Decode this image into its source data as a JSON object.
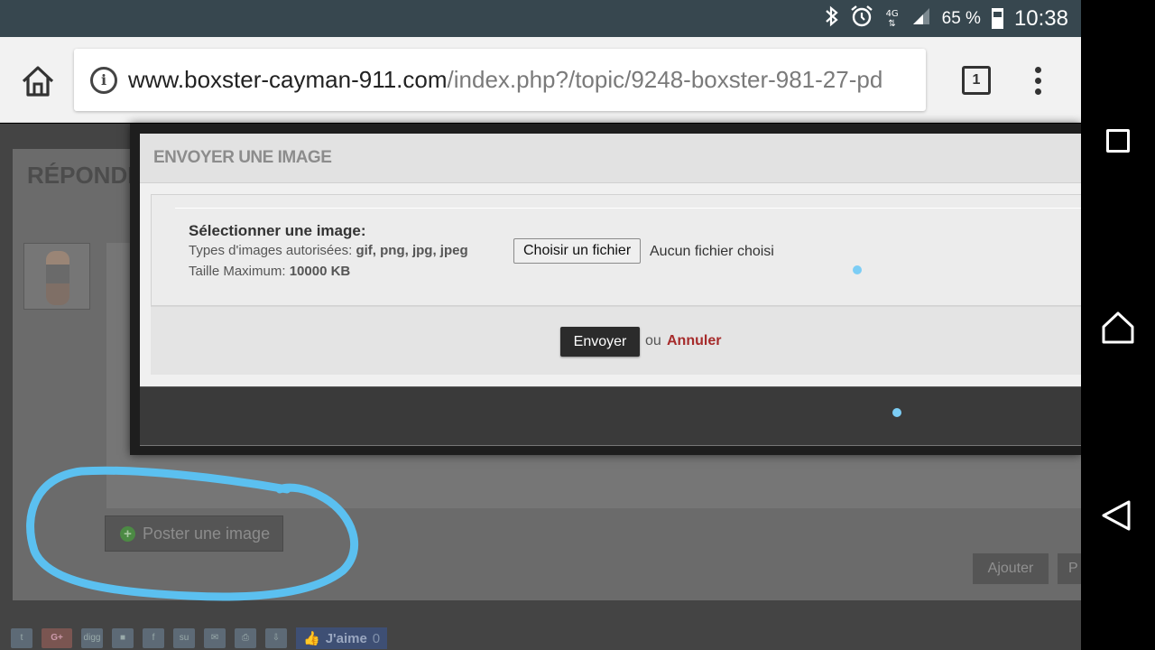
{
  "status_bar": {
    "network": "4G",
    "battery_percent": "65 %",
    "time": "10:38",
    "icons": [
      "bluetooth-icon",
      "alarm-icon",
      "data-arrows-icon",
      "signal-icon",
      "battery-icon"
    ]
  },
  "browser": {
    "url_domain": "www.boxster-cayman-911.com",
    "url_path": "/index.php?/topic/9248-boxster-981-27-pd",
    "tab_count": "1"
  },
  "page": {
    "reply_title": "RÉPONDRE",
    "post_image_label": "Poster une image",
    "add_label": "Ajouter",
    "second_action_label": "P",
    "share_icons": [
      "twitter-icon",
      "google-plus-icon",
      "digg-icon",
      "delicious-icon",
      "facebook-icon",
      "stumbleupon-icon",
      "email-icon",
      "print-icon",
      "download-icon"
    ],
    "google_plus_label": "G+",
    "digg_label": "digg",
    "like_label": "J'aime",
    "like_count": "0"
  },
  "modal": {
    "title": "ENVOYER UNE IMAGE",
    "field_label": "Sélectionner une image:",
    "types_prefix": "Types d'images autorisées:",
    "types_value": "gif, png, jpg, jpeg",
    "size_prefix": "Taille Maximum:",
    "size_value": "10000 KB",
    "choose_file_label": "Choisir un fichier",
    "no_file_label": "Aucun fichier choisi",
    "submit_label": "Envoyer",
    "or_label": "ou",
    "cancel_label": "Annuler"
  },
  "colors": {
    "annotation": "#5bc0f0",
    "cancel_link": "#a62b2b",
    "status_bar": "#37474f"
  }
}
